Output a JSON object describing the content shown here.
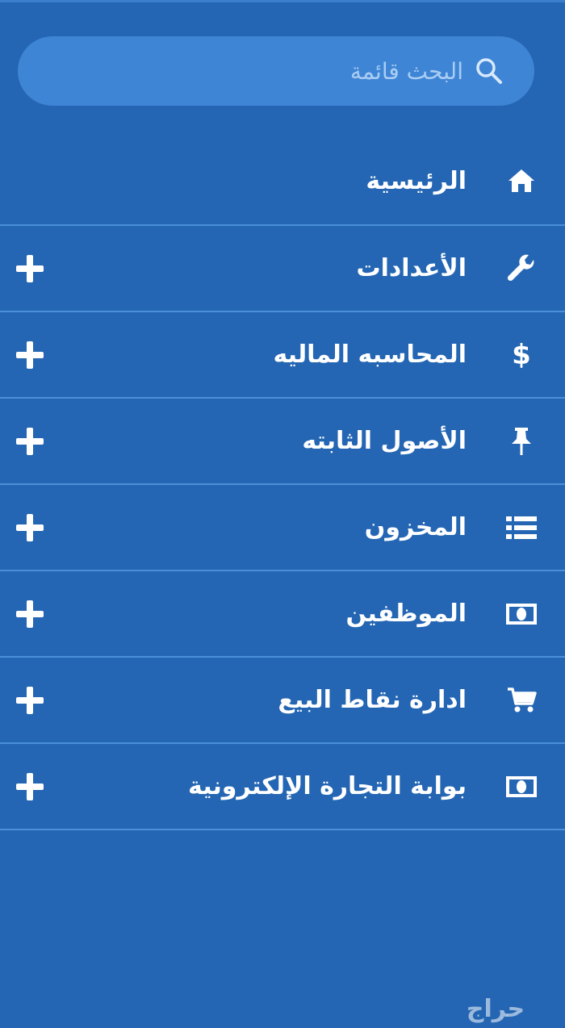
{
  "search": {
    "placeholder": "البحث قائمة"
  },
  "menu": {
    "items": [
      {
        "label": "الرئيسية",
        "icon": "home-icon",
        "expandable": false
      },
      {
        "label": "الأعدادات",
        "icon": "wrench-icon",
        "expandable": true
      },
      {
        "label": "المحاسبه الماليه",
        "icon": "dollar-icon",
        "expandable": true
      },
      {
        "label": "الأصول الثابته",
        "icon": "pin-icon",
        "expandable": true
      },
      {
        "label": "المخزون",
        "icon": "list-icon",
        "expandable": true
      },
      {
        "label": "الموظفين",
        "icon": "money-icon",
        "expandable": true
      },
      {
        "label": "ادارة نقاط البيع",
        "icon": "cart-icon",
        "expandable": true
      },
      {
        "label": "بوابة التجارة الإلكترونية",
        "icon": "money-icon",
        "expandable": true
      }
    ]
  },
  "watermark": {
    "text": "حراج"
  },
  "colors": {
    "background": "#2466b3",
    "search_background": "#3f85d6",
    "divider": "#4b8fd9",
    "text": "#ffffff"
  }
}
